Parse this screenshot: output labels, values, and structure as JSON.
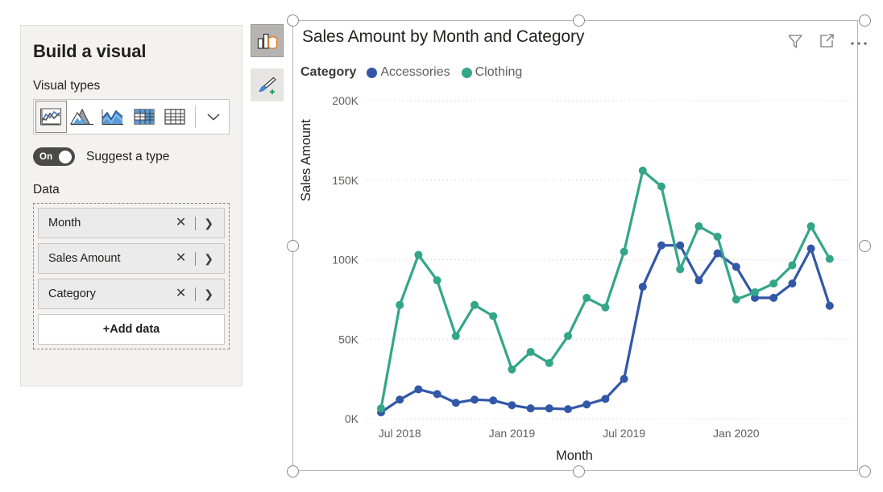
{
  "build_pane": {
    "title": "Build a visual",
    "visual_types_label": "Visual types",
    "visual_types": [
      {
        "name": "line-chart",
        "selected": true
      },
      {
        "name": "area-chart",
        "selected": false
      },
      {
        "name": "line-and-stacked-area-chart",
        "selected": false
      },
      {
        "name": "matrix",
        "selected": false
      },
      {
        "name": "table",
        "selected": false
      }
    ],
    "more_types_icon": "chevron-down-icon",
    "suggest": {
      "toggle_state": "On",
      "label": "Suggest a type"
    },
    "data_label": "Data",
    "fields": [
      {
        "name": "Month",
        "remove_icon": "close-icon",
        "expand_icon": "chevron-right-icon"
      },
      {
        "name": "Sales Amount",
        "remove_icon": "close-icon",
        "expand_icon": "chevron-right-icon"
      },
      {
        "name": "Category",
        "remove_icon": "close-icon",
        "expand_icon": "chevron-right-icon"
      }
    ],
    "add_data_label": "+Add data"
  },
  "side_buttons": [
    {
      "name": "build-visual-icon",
      "selected": true
    },
    {
      "name": "format-visual-icon",
      "selected": false
    }
  ],
  "card": {
    "title": "Sales Amount by Month and Category",
    "icons": [
      {
        "name": "filter-icon"
      },
      {
        "name": "focus-mode-icon"
      },
      {
        "name": "more-options-icon"
      }
    ]
  },
  "colors": {
    "accessories": "#3257A8",
    "clothing": "#33A68A",
    "gridline": "#d0cece",
    "axis_text": "#605e5c",
    "title_text": "#252423",
    "card_border": "#b3b3b3",
    "pane_bg": "#f3f2f1"
  },
  "chart_data": {
    "type": "line",
    "title": "Sales Amount by Month and Category",
    "xlabel": "Month",
    "ylabel": "Sales Amount",
    "legend_title": "Category",
    "legend_position": "top",
    "grid": true,
    "ylim": [
      0,
      200000
    ],
    "yticks": [
      0,
      50000,
      100000,
      150000,
      200000
    ],
    "ytick_labels": [
      "0K",
      "50K",
      "100K",
      "150K",
      "200K"
    ],
    "xtick_labels": [
      "Jul 2018",
      "Jan 2019",
      "Jul 2019",
      "Jan 2020"
    ],
    "xtick_indices": [
      1,
      7,
      13,
      19
    ],
    "categories": [
      "Jun 2018",
      "Jul 2018",
      "Aug 2018",
      "Sep 2018",
      "Oct 2018",
      "Nov 2018",
      "Dec 2018",
      "Jan 2019",
      "Feb 2019",
      "Mar 2019",
      "Apr 2019",
      "May 2019",
      "Jun 2019",
      "Jul 2019",
      "Aug 2019",
      "Sep 2019",
      "Oct 2019",
      "Nov 2019",
      "Dec 2019",
      "Jan 2020",
      "Feb 2020",
      "Mar 2020",
      "Apr 2020",
      "May 2020",
      "Jun 2020"
    ],
    "series": [
      {
        "name": "Accessories",
        "color": "#3257A8",
        "values": [
          4000,
          12000,
          18500,
          15500,
          10000,
          12000,
          11500,
          8500,
          6500,
          6500,
          6000,
          9000,
          12500,
          25000,
          83000,
          109000,
          109000,
          87000,
          104000,
          95500,
          76000,
          76000,
          85000,
          107000,
          71000
        ]
      },
      {
        "name": "Clothing",
        "color": "#33A68A",
        "values": [
          6500,
          71500,
          103000,
          87000,
          52000,
          71500,
          64500,
          31000,
          42000,
          35000,
          52000,
          76000,
          70000,
          105000,
          156000,
          146000,
          94000,
          121000,
          114500,
          75000,
          79500,
          85000,
          96500,
          121000,
          100500
        ]
      }
    ]
  }
}
